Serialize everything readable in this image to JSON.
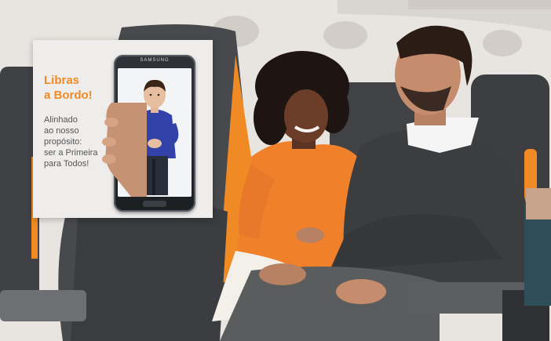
{
  "promo": {
    "title_line1": "Libras",
    "title_line2": "a Bordo!",
    "body_line1": "Alinhado",
    "body_line2": "ao nosso",
    "body_line3": "propósito:",
    "body_line4": "ser a Primeira",
    "body_line5": "para Todos!"
  },
  "phone": {
    "brand": "SAMSUNG"
  },
  "colors": {
    "accent_orange": "#f08a24",
    "seat_gray": "#4a4c4f",
    "cabin_wall": "#e8e5e1"
  }
}
